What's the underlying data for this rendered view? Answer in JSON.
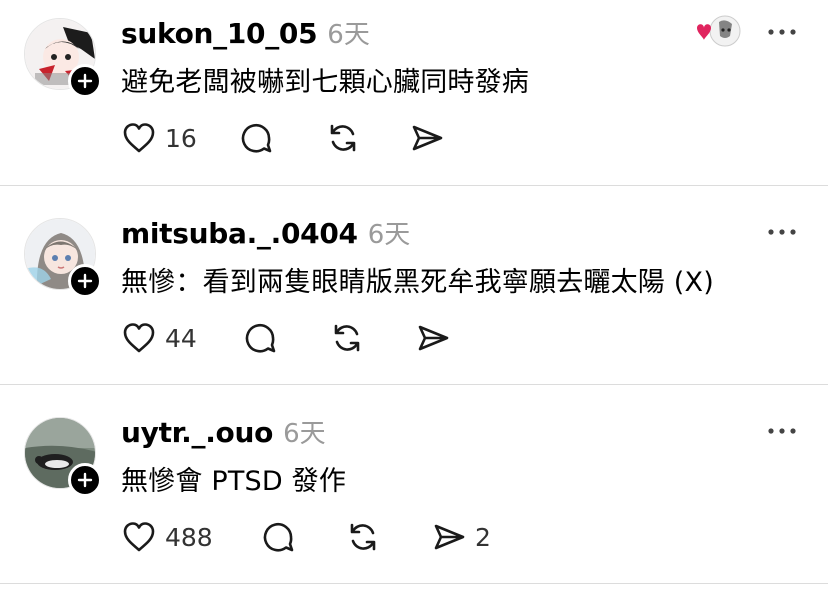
{
  "posts": [
    {
      "username": "sukon_10_05",
      "time": "6天",
      "content": "避免老闆被嚇到七顆心臟同時發病",
      "likes": "16",
      "shares": "",
      "liked_by_author": true,
      "avatar_icon": "anime-character-avatar"
    },
    {
      "username": "mitsuba._.0404",
      "time": "6天",
      "content": "無慘：看到兩隻眼睛版黑死牟我寧願去曬太陽 (X)",
      "likes": "44",
      "shares": "",
      "liked_by_author": false,
      "avatar_icon": "anime-girl-avatar"
    },
    {
      "username": "uytr._.ouo",
      "time": "6天",
      "content": "無慘會 PTSD 發作",
      "likes": "488",
      "shares": "2",
      "liked_by_author": false,
      "avatar_icon": "penguin-photo-avatar"
    }
  ],
  "icons": {
    "like": "heart-outline-icon",
    "reply": "speech-bubble-icon",
    "repost": "repost-arrows-icon",
    "share": "send-arrow-icon",
    "more": "ellipsis-icon",
    "follow": "plus-icon"
  },
  "colors": {
    "text": "#000000",
    "secondary": "#9a9a9a",
    "heart_red": "#e0245e",
    "divider": "#dcdcdc"
  }
}
